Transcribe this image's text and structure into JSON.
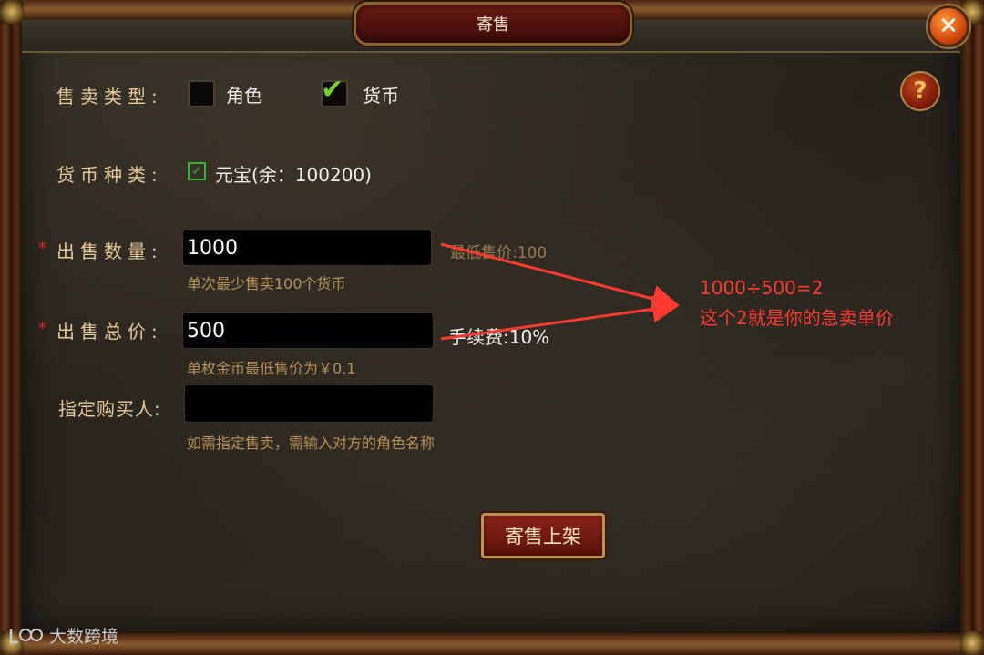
{
  "dialog": {
    "title": "寄售",
    "close_icon": "close-icon",
    "help_symbol": "?"
  },
  "sale_type": {
    "label": "售卖类型:",
    "options": [
      {
        "label": "角色",
        "checked": false
      },
      {
        "label": "货币",
        "checked": true
      }
    ]
  },
  "currency_type": {
    "label": "货币种类:",
    "value": "元宝(余：100200)",
    "checked": true
  },
  "quantity": {
    "required_mark": "*",
    "label": "出售数量:",
    "value": "1000",
    "side_hint": "最低售价:100",
    "hint": "单次最少售卖100个货币"
  },
  "total_price": {
    "required_mark": "*",
    "label": "出售总价:",
    "value": "500",
    "fee_text": "手续费:10%",
    "hint": "单枚金币最低售价为￥0.1"
  },
  "buyer": {
    "label": "指定购买人:",
    "value": "",
    "hint": "如需指定售卖，需输入对方的角色名称"
  },
  "submit_label": "寄售上架",
  "annotation": {
    "line1": "1000÷500=2",
    "line2": "这个2就是你的急卖单价",
    "color": "#ff3a30"
  },
  "watermark": "大数跨境"
}
